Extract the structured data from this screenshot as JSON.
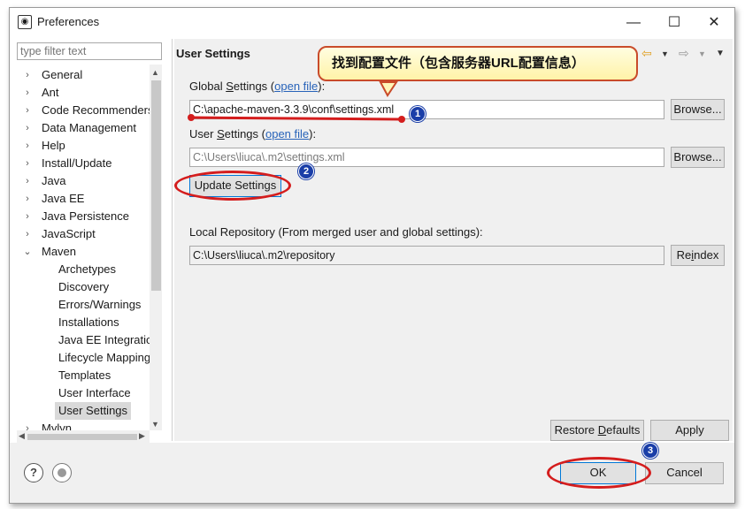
{
  "window": {
    "title": "Preferences",
    "minimize": "—",
    "maximize": "☐",
    "close": "✕"
  },
  "filter": {
    "placeholder": "type filter text"
  },
  "tree": {
    "items": [
      {
        "label": "General",
        "arrow": "›"
      },
      {
        "label": "Ant",
        "arrow": "›"
      },
      {
        "label": "Code Recommenders",
        "arrow": "›"
      },
      {
        "label": "Data Management",
        "arrow": "›"
      },
      {
        "label": "Help",
        "arrow": "›"
      },
      {
        "label": "Install/Update",
        "arrow": "›"
      },
      {
        "label": "Java",
        "arrow": "›"
      },
      {
        "label": "Java EE",
        "arrow": "›"
      },
      {
        "label": "Java Persistence",
        "arrow": "›"
      },
      {
        "label": "JavaScript",
        "arrow": "›"
      },
      {
        "label": "Maven",
        "arrow": "⌄"
      },
      {
        "label": "Archetypes"
      },
      {
        "label": "Discovery"
      },
      {
        "label": "Errors/Warnings"
      },
      {
        "label": "Installations"
      },
      {
        "label": "Java EE Integration"
      },
      {
        "label": "Lifecycle Mapping"
      },
      {
        "label": "Templates"
      },
      {
        "label": "User Interface"
      },
      {
        "label": "User Settings",
        "selected": true
      },
      {
        "label": "Mylyn",
        "arrow": "›"
      }
    ]
  },
  "page": {
    "title": "User Settings",
    "global_label_pre": "Global ",
    "global_label_key": "S",
    "global_label_post": "ettings (",
    "global_link": "open file",
    "global_label_end": "):",
    "global_value": "C:\\apache-maven-3.3.9\\conf\\settings.xml",
    "user_label_pre": "User ",
    "user_label_key": "S",
    "user_label_post": "ettings (",
    "user_link": "open file",
    "user_label_end": "):",
    "user_value": "C:\\Users\\liuca\\.m2\\settings.xml",
    "browse": "Browse...",
    "update": "Update Settings",
    "local_label": "Local Repository (From merged user and global settings):",
    "local_value": "C:\\Users\\liuca\\.m2\\repository",
    "reindex_pre": "Re",
    "reindex_key": "i",
    "reindex_post": "ndex",
    "restore_pre": "Restore ",
    "restore_key": "D",
    "restore_post": "efaults",
    "apply": "Apply"
  },
  "footer": {
    "ok": "OK",
    "cancel": "Cancel",
    "help_icon": "?"
  },
  "annotations": {
    "callout": "找到配置文件（包含服务器URL配置信息）",
    "badge1": "1",
    "badge2": "2",
    "badge3": "3",
    "accent": "#d41d1d"
  }
}
